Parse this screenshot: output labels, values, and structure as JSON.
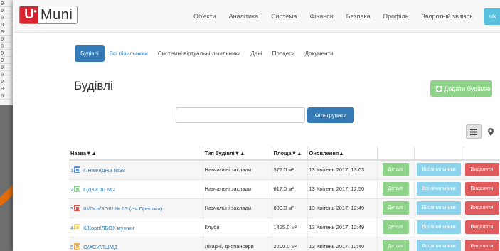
{
  "background": {
    "log_lines": [
      "0",
      "0",
      "0",
      "0",
      "0",
      "0",
      "0",
      "0",
      "0",
      "0",
      "0",
      "0",
      "0",
      "0"
    ],
    "arrow_color": "#e36c09"
  },
  "navbar": {
    "logo_letter": "U",
    "logo_sup": "●",
    "logo_text": "Muni",
    "items": [
      "Об'єкти",
      "Аналітика",
      "Система",
      "Фінанси",
      "Безпека",
      "Профіль",
      "Зворотній зв'язок"
    ],
    "language": "uk"
  },
  "tabs": [
    {
      "label": "Будівлі",
      "active": true
    },
    {
      "label": "Всі лічильники",
      "active": false
    },
    {
      "label": "Системні віртуальні лічильники",
      "active": false
    },
    {
      "label": "Дані",
      "active": false
    },
    {
      "label": "Процеси",
      "active": false
    },
    {
      "label": "Документи",
      "active": false
    }
  ],
  "page": {
    "title": "Будівлі",
    "add_button": "Додати будівлю",
    "filter_value": "",
    "filter_button": "Фільтрувати"
  },
  "table": {
    "headers": [
      "Назва▼▲",
      "Тип будівлі▼▲",
      "Площа▼▲",
      "Оновлення▲"
    ],
    "rows": [
      {
        "num": "1",
        "icon_color": "#5b8fd6",
        "name": "Г/Навч/ДНЗ №38",
        "type": "Навчальні заклади",
        "area": "372.0 м²",
        "updated": "13 Квітень 2017, 13:03"
      },
      {
        "num": "2",
        "icon_color": "#8fd28a",
        "name": "Г/ДЮСШ №2",
        "type": "Навчальні заклади",
        "area": "617.0 м²",
        "updated": "13 Квітень 2017, 12:50"
      },
      {
        "num": "3",
        "icon_color": "#d9534f",
        "name": "Ш/Осн/ЗОШ № 53 (г-я Престиж)",
        "type": "Навчальні заклади",
        "area": "800.0 м²",
        "updated": "13 Квітень 2017, 12:49"
      },
      {
        "num": "4",
        "icon_color": "#f3d36b",
        "name": "К/Корп/ЛБОК музики",
        "type": "Клуби",
        "area": "1425.0 м²",
        "updated": "13 Квітень 2017, 12:49"
      },
      {
        "num": "5",
        "icon_color": "#f0ad4e",
        "name": "О/АСУ/ЛШМД",
        "type": "Лікарні, диспансери",
        "area": "2200.0 м²",
        "updated": "13 Квітень 2017, 12:40"
      }
    ],
    "details_label": "Деталі",
    "meters_label": "Всі лічильники",
    "delete_label": "Видалити"
  }
}
